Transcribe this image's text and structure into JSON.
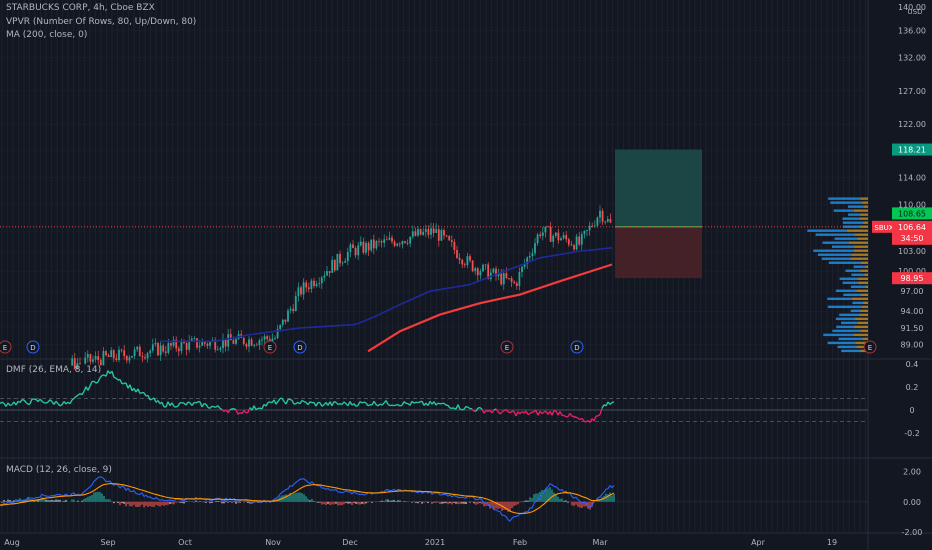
{
  "colors": {
    "background": "#131722",
    "grid": "#232735",
    "text": "#b2b5be",
    "up": "#26a69a",
    "down": "#ef5350",
    "ma": "#f23b3b",
    "vwap": "#1e2a9b",
    "dmf_up": "#26c6a0",
    "dmf_down": "#e91e63",
    "macd": "#2962ff",
    "signal": "#ff9800",
    "profit_zone": "#1e4a4a",
    "loss_zone": "#4a2128",
    "vol_up": "#2196f3",
    "vol_down": "#c69026",
    "price_badge": "#f23645",
    "target_badge": "#089981",
    "current_badge": "#00c853"
  },
  "header": {
    "symbol_line": "STARBUCKS CORP, 4h, Cboe BZX",
    "indicator_1": "VPVR (Number Of Rows, 80, Up/Down, 80)",
    "indicator_2": "MA (200, close, 0)"
  },
  "price_axis": {
    "currency": "USD",
    "ticks": [
      "136.00",
      "132.00",
      "127.00",
      "122.00",
      "118.00",
      "114.00",
      "110.00",
      "106.00",
      "103.00",
      "100.00",
      "97.00",
      "94.00",
      "91.50",
      "89.00"
    ],
    "top_label": "140.00"
  },
  "badges": {
    "target": "118.21",
    "current": "108.65",
    "symbol": "SBUX",
    "last_price": "106.64",
    "countdown": "34:50",
    "stop": "98.95"
  },
  "time_axis": {
    "labels": [
      "Aug",
      "Sep",
      "Oct",
      "Nov",
      "Dec",
      "2021",
      "Feb",
      "Mar",
      "Apr",
      "19"
    ]
  },
  "events": {
    "earnings_label": "E",
    "dividend_label": "D"
  },
  "dmf": {
    "title": "DMF (26, EMA, 8, 14)",
    "ticks": [
      "0.4",
      "0.2",
      "0",
      "-0.2"
    ]
  },
  "macd": {
    "title": "MACD (12, 26, close, 9)",
    "ticks": [
      "2.00",
      "0.00",
      "-2.00"
    ]
  },
  "chart_data": {
    "type": "candlestick",
    "title": "STARBUCKS CORP, 4h, Cboe BZX",
    "x_labels": [
      "Aug",
      "Sep",
      "Oct",
      "Nov",
      "Dec",
      "2021",
      "Feb",
      "Mar",
      "Apr",
      "19"
    ],
    "price_range": [
      87,
      140
    ],
    "price_trend": [
      {
        "x": "Aug",
        "close": 84
      },
      {
        "x": "Sep",
        "close": 87
      },
      {
        "x": "Oct",
        "close": 89
      },
      {
        "x": "Nov",
        "close": 90
      },
      {
        "x": "Nov",
        "close": 97
      },
      {
        "x": "Dec",
        "close": 103
      },
      {
        "x": "2021",
        "close": 106
      },
      {
        "x": "Feb",
        "close": 98
      },
      {
        "x": "Feb",
        "close": 106
      },
      {
        "x": "Mar",
        "close": 106.64
      }
    ],
    "ma200": [
      {
        "x": "Nov",
        "value": 87
      },
      {
        "x": "Dec",
        "value": 92
      },
      {
        "x": "2021",
        "value": 94.5
      },
      {
        "x": "Feb",
        "value": 97
      },
      {
        "x": "Mar",
        "value": 101
      }
    ],
    "position": {
      "entry": 106.64,
      "target": 118.21,
      "stop": 98.95
    },
    "dmf_range": [
      -0.4,
      0.4
    ],
    "dmf_levels": [
      0.1,
      0,
      -0.1
    ],
    "macd_range": [
      -2,
      2.5
    ]
  }
}
